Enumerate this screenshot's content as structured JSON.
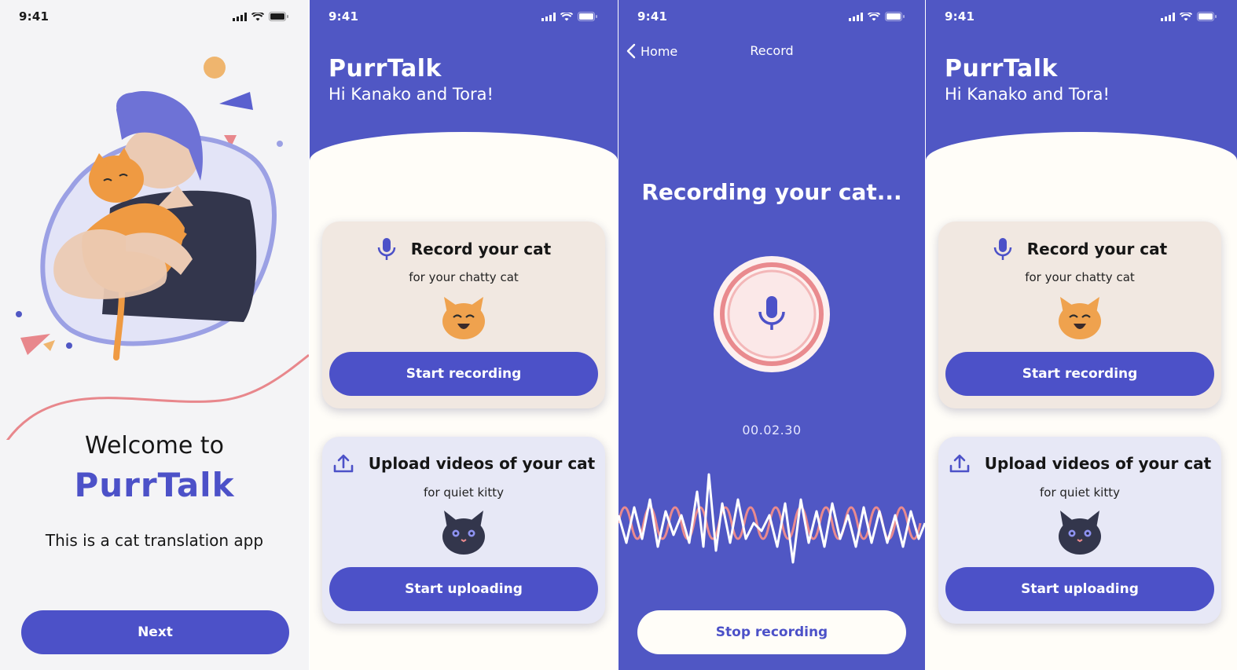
{
  "status": {
    "time": "9:41"
  },
  "onboarding": {
    "welcome": "Welcome to",
    "brand": "PurrTalk",
    "description": "This is a cat translation app",
    "next_label": "Next"
  },
  "home": {
    "brand": "PurrTalk",
    "greeting": "Hi Kanako and Tora!",
    "record_card": {
      "title": "Record your cat",
      "subtitle": "for your chatty cat",
      "button": "Start recording"
    },
    "upload_card": {
      "title": "Upload videos of your cat",
      "subtitle": "for quiet kitty",
      "button": "Start uploading"
    }
  },
  "record": {
    "back_label": "Home",
    "nav_title": "Record",
    "title": "Recording your cat...",
    "timer": "00.02.30",
    "stop_label": "Stop recording"
  },
  "colors": {
    "primary": "#4c51c8",
    "header": "#5057c4",
    "cream": "#fffdf8",
    "record_card": "#f1e8e1",
    "upload_card": "#e7e8f6",
    "accent_pink": "#e98a8e"
  },
  "icons": [
    "signal-icon",
    "wifi-icon",
    "battery-icon",
    "mic-icon",
    "upload-icon",
    "chevron-left-icon",
    "orange-cat-icon",
    "black-cat-icon"
  ]
}
